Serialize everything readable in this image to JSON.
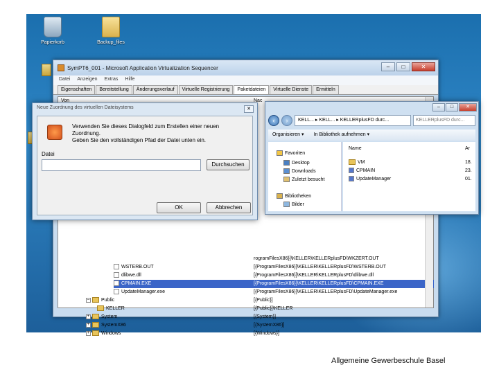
{
  "desktop": {
    "icons": [
      {
        "label": "Papierkorb"
      },
      {
        "label": "Backup_files"
      }
    ]
  },
  "sequencer": {
    "title": "SymPT6_001 - Microsoft Application Virtualization Sequencer",
    "menu": [
      "Datei",
      "Anzeigen",
      "Extras",
      "Hilfe"
    ],
    "tabs": [
      "Eigenschaften",
      "Bereitstellung",
      "Änderungsverlauf",
      "Virtuelle Registrierung",
      "Paketdateien",
      "Virtuelle Dienste",
      "Ermitteln"
    ],
    "active_tab": "Paketdateien",
    "von_label": "Von",
    "nach_label": "Nac",
    "rows": [
      {
        "name": "WSTERB.OUT",
        "path": "[{ProgramFilesX86}]\\KELLER\\KELLERplusFD\\WSTERB.OUT",
        "selected": false
      },
      {
        "name": "dlibwe.dll",
        "path": "[{ProgramFilesX86}]\\KELLER\\KELLERplusFD\\dlibwe.dll",
        "selected": false
      },
      {
        "name": "CPMAIN.EXE",
        "path": "[{ProgramFilesX86}]\\KELLER\\KELLERplusFD\\CPMAIN.EXE",
        "selected": true
      },
      {
        "name": "UpdateManager.exe",
        "path": "[{ProgramFilesX86}]\\KELLER\\KELLERplusFD\\UpdateManager.exe",
        "selected": false
      },
      {
        "name": "Public",
        "path": "[{Public}]",
        "selected": false
      },
      {
        "name": "KELLER",
        "path": "[{Public}]\\KELLER",
        "selected": false
      },
      {
        "name": "System",
        "path": "[{System}]",
        "selected": false
      },
      {
        "name": "SystemX86",
        "path": "[{SystemX86}]",
        "selected": false
      },
      {
        "name": "Windows",
        "path": "[{Windows}]",
        "selected": false
      }
    ],
    "top_path": "rogramFilesX86}]\\KELLER\\KELLERplusFD\\WKZERT.OUT"
  },
  "dialog": {
    "title": "Neue Zuordnung des virtuellen Dateisystems",
    "message": [
      "Verwenden Sie dieses Dialogfeld zum Erstellen einer neuen",
      "Zuordnung.",
      "Geben Sie den vollständigen Pfad der Datei unten ein."
    ],
    "field_label": "Datei",
    "field_value": "",
    "browse_label": "Durchsuchen",
    "ok_label": "OK",
    "cancel_label": "Abbrechen"
  },
  "explorer": {
    "address": "KELL... ▸ KELL... ▸ KELLERplusFD durc...",
    "search_placeholder": "KELLERplusFD durc...",
    "organize_label": "Organisieren ▾",
    "library_label": "In Bibliothek aufnehmen ▾",
    "nav": [
      "Favoriten",
      "Desktop",
      "Downloads",
      "Zuletzt besucht",
      "Bibliotheken",
      "Bilder"
    ],
    "column_name": "Name",
    "column_date": "Ar",
    "files": [
      {
        "name": "VM",
        "date": "18."
      },
      {
        "name": "CPMAIN",
        "date": "23."
      },
      {
        "name": "UpdateManager",
        "date": "01."
      }
    ]
  },
  "footer": {
    "text": "Allgemeine Gewerbeschule Basel"
  },
  "colors": {
    "selection": "#3b65c8",
    "desktop": "#2f86c6"
  }
}
